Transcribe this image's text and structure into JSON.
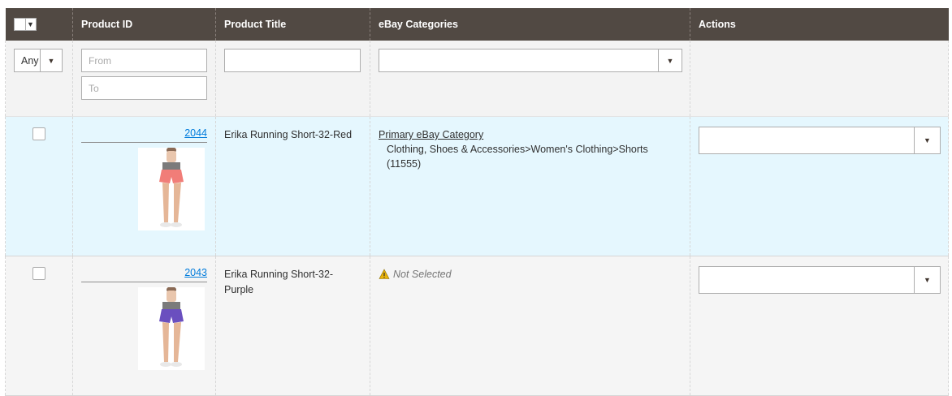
{
  "header": {
    "product_id": "Product ID",
    "product_title": "Product Title",
    "ebay_categories": "eBay Categories",
    "actions": "Actions"
  },
  "filters": {
    "select_any": "Any",
    "id_from_placeholder": "From",
    "id_to_placeholder": "To",
    "title_value": "",
    "category_value": ""
  },
  "rows": [
    {
      "id": "2044",
      "title": "Erika Running Short-32-Red",
      "category_label": "Primary eBay Category",
      "category_path": "Clothing, Shoes & Accessories>Women's Clothing>Shorts (11555)",
      "shorts_color": "#f17d78",
      "action_value": ""
    },
    {
      "id": "2043",
      "title": "Erika Running Short-32-Purple",
      "category_status": "Not Selected",
      "shorts_color": "#6a4fbf",
      "action_value": ""
    }
  ],
  "colors": {
    "header_bg": "#514943",
    "highlight_row": "#e5f7fe",
    "link": "#007bdb",
    "warning": "#eab308"
  }
}
